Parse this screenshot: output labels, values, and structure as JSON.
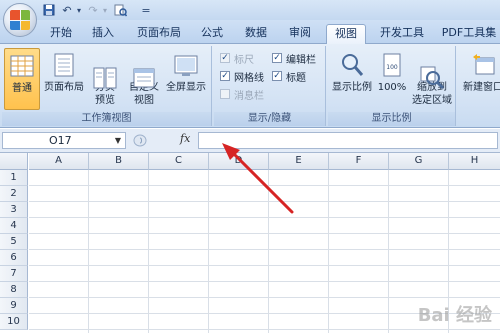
{
  "quick_access": {
    "undo": "↶",
    "redo": "↷",
    "customize": "="
  },
  "tabs": [
    "开始",
    "插入",
    "页面布局",
    "公式",
    "数据",
    "审阅",
    "视图",
    "开发工具",
    "PDF工具集"
  ],
  "active_tab": "视图",
  "ribbon": {
    "workbook_views": {
      "label": "工作簿视图",
      "buttons": [
        "普通",
        "页面布局",
        "分页\n预览",
        "自定义\n视图",
        "全屏显示"
      ]
    },
    "show_hide": {
      "label": "显示/隐藏",
      "items": [
        {
          "label": "标尺",
          "checked": true,
          "disabled": true
        },
        {
          "label": "网格线",
          "checked": true,
          "disabled": false
        },
        {
          "label": "消息栏",
          "checked": false,
          "disabled": true
        },
        {
          "label": "编辑栏",
          "checked": true,
          "disabled": false
        },
        {
          "label": "标题",
          "checked": true,
          "disabled": false
        }
      ]
    },
    "zoom": {
      "label": "显示比例",
      "buttons": [
        "显示比例",
        "100%",
        "缩放到\n选定区域"
      ]
    },
    "window": {
      "new_window": "新建窗口"
    }
  },
  "formula_bar": {
    "name_box": "O17",
    "fx": "fx",
    "formula": ""
  },
  "grid": {
    "columns": [
      "A",
      "B",
      "C",
      "D",
      "E",
      "F",
      "G",
      "H"
    ],
    "rows": [
      "1",
      "2",
      "3",
      "4",
      "5",
      "6",
      "7",
      "8",
      "9",
      "10"
    ]
  },
  "watermark": "Bai 经验",
  "colors": {
    "arrow": "#d62424",
    "selected_button": "#ffc24e",
    "ribbon": "#d3e2f4"
  }
}
